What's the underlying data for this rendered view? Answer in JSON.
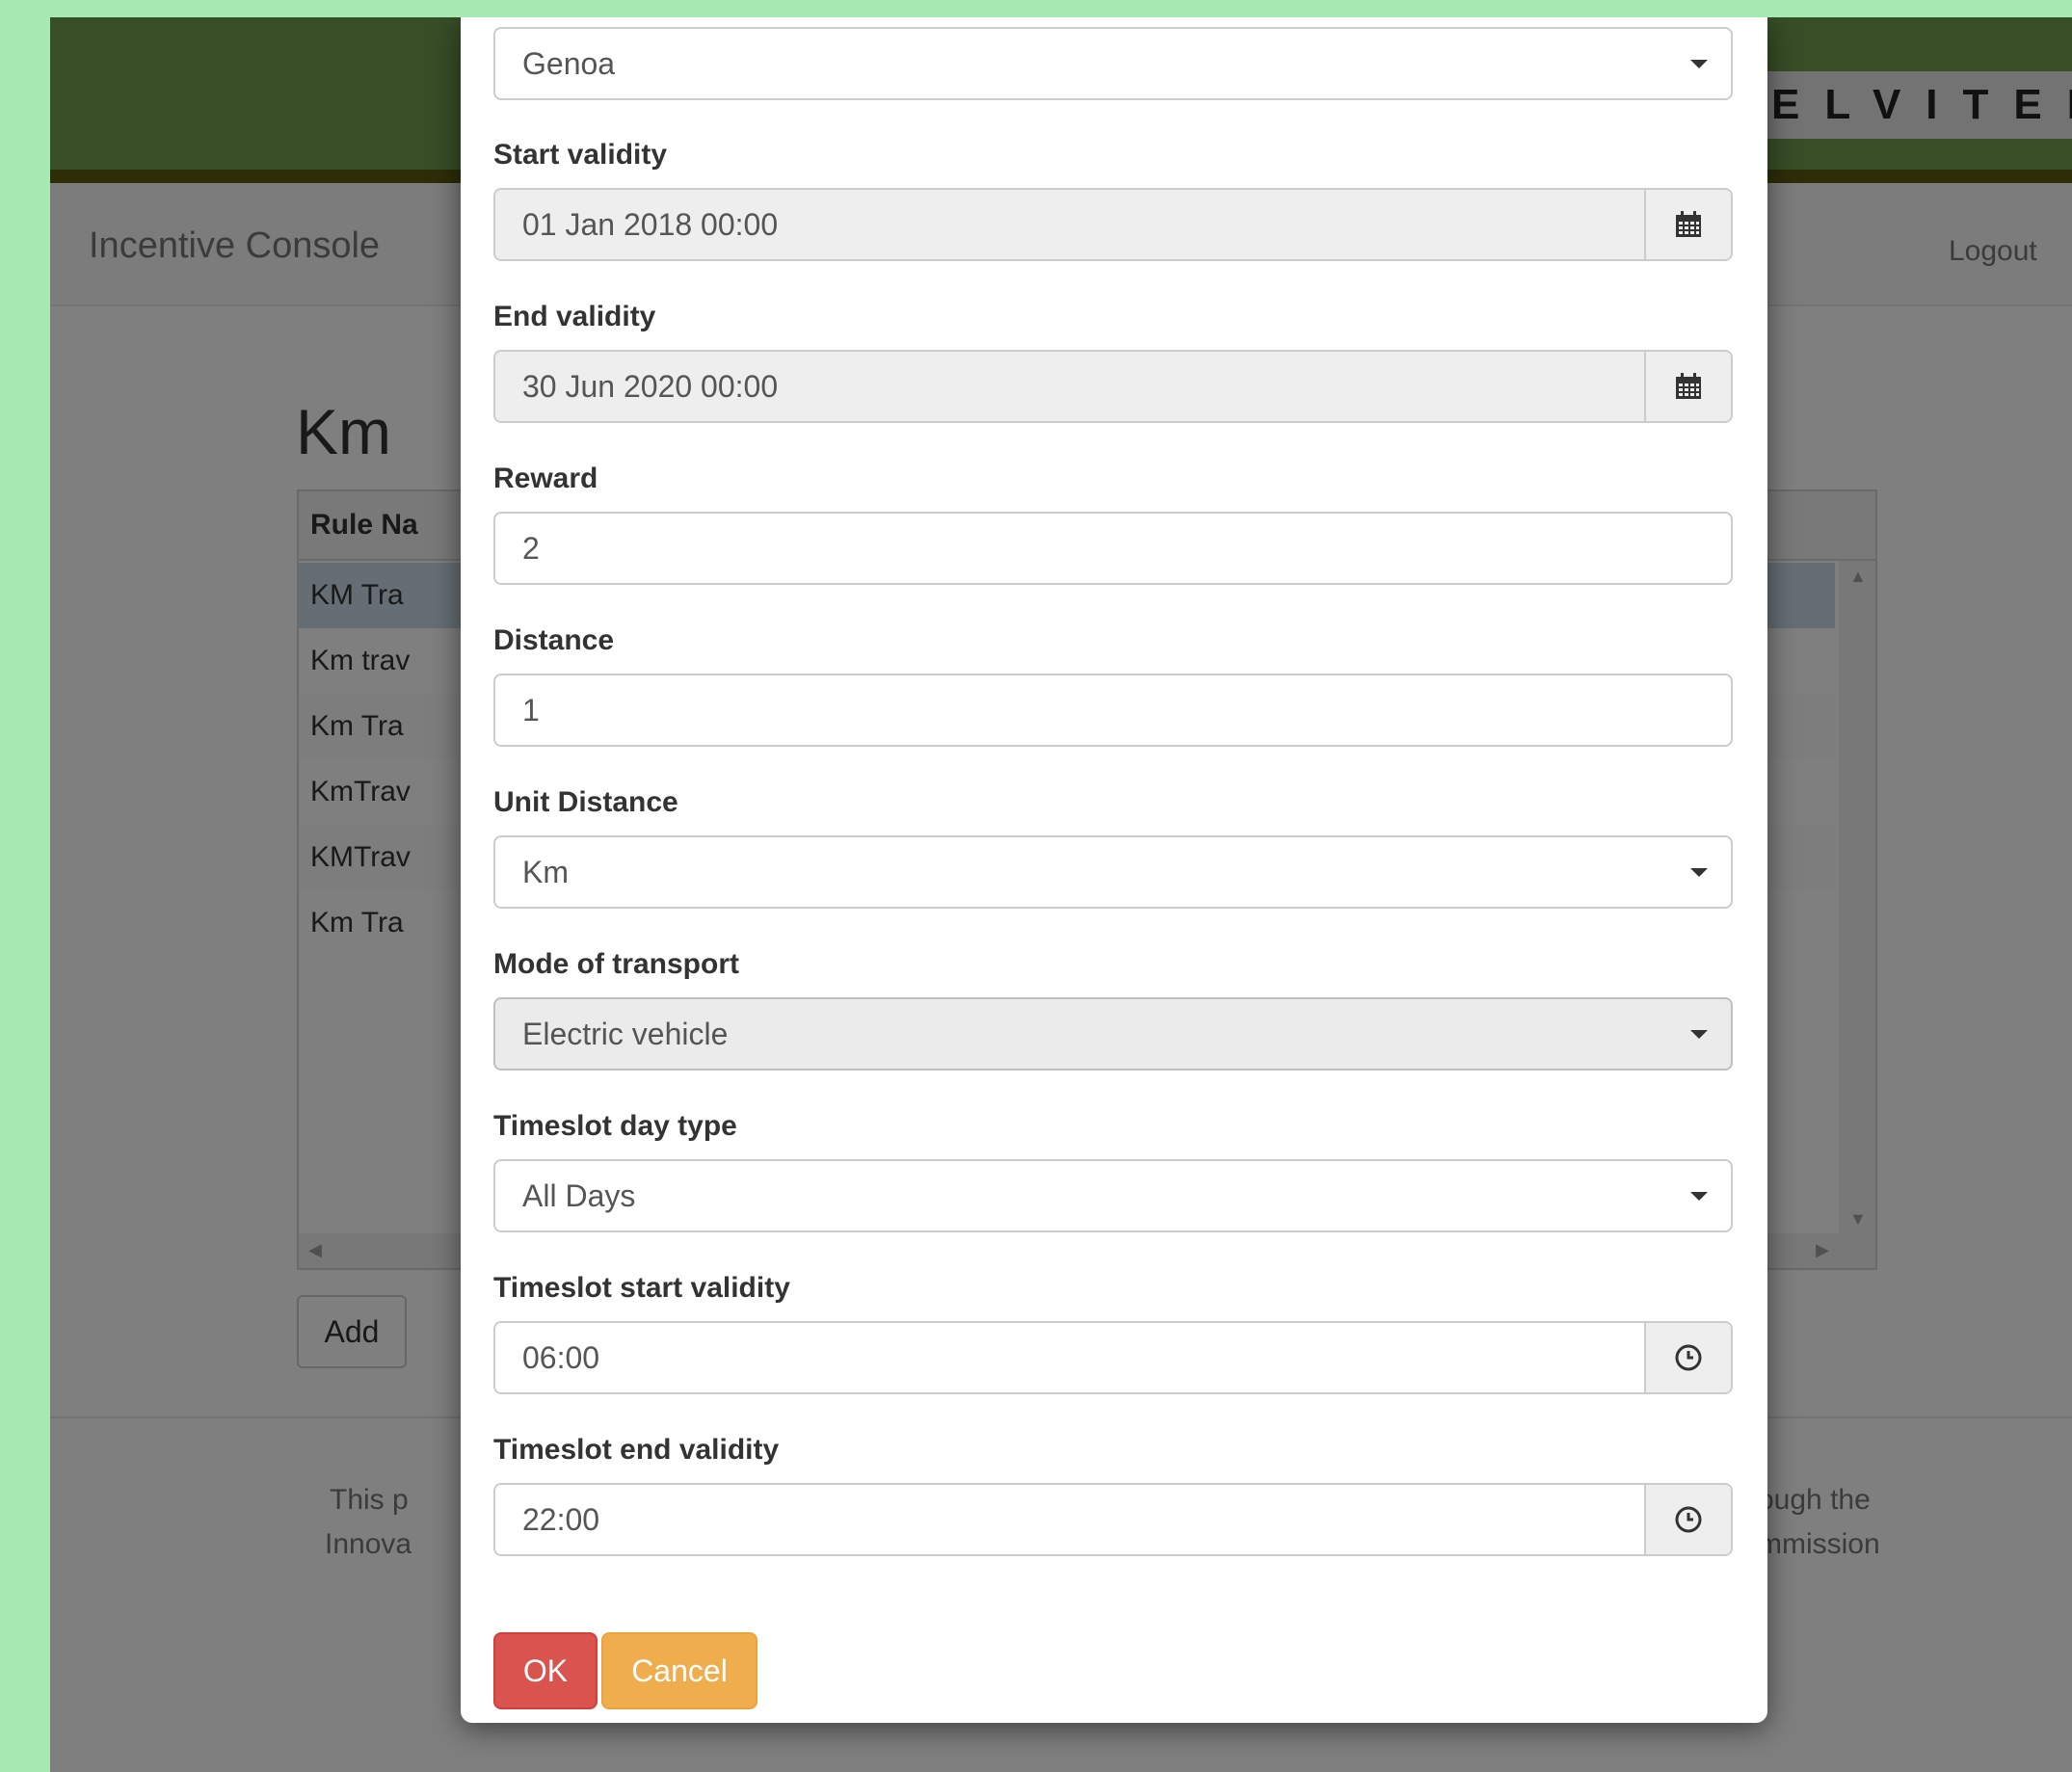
{
  "app": {
    "logo_text": "ELVITEN",
    "brand": "Incentive Console",
    "logout_label": "Logout"
  },
  "background_page": {
    "title": "Km",
    "grid": {
      "header_first_col": "Rule Na",
      "rows": [
        "KM Tra",
        "Km trav",
        "Km Tra",
        "KmTrav",
        "KMTrav",
        "Km Tra"
      ]
    },
    "add_label": "Add",
    "footer_left_line1": "This p",
    "footer_left_line2": "Innova",
    "footer_right_line1": "ough the",
    "footer_right_line2": "mmission"
  },
  "modal": {
    "city": {
      "value": "Genoa"
    },
    "start_validity": {
      "label": "Start validity",
      "value": "01 Jan 2018 00:00"
    },
    "end_validity": {
      "label": "End validity",
      "value": "30 Jun 2020 00:00"
    },
    "reward": {
      "label": "Reward",
      "value": "2"
    },
    "distance": {
      "label": "Distance",
      "value": "1"
    },
    "unit_distance": {
      "label": "Unit Distance",
      "value": "Km"
    },
    "mode_of_transport": {
      "label": "Mode of transport",
      "value": "Electric vehicle"
    },
    "timeslot_day_type": {
      "label": "Timeslot day type",
      "value": "All Days"
    },
    "timeslot_start": {
      "label": "Timeslot start validity",
      "value": "06:00"
    },
    "timeslot_end": {
      "label": "Timeslot end validity",
      "value": "22:00"
    },
    "ok_label": "OK",
    "cancel_label": "Cancel"
  },
  "icons": {
    "calendar": "calendar-icon",
    "clock": "clock-icon",
    "caret": "chevron-down-icon"
  },
  "colors": {
    "banner": "#6e9c4e",
    "ok": "#d9534f",
    "cancel": "#f0ad4e",
    "selected_row": "#c9dde8"
  }
}
